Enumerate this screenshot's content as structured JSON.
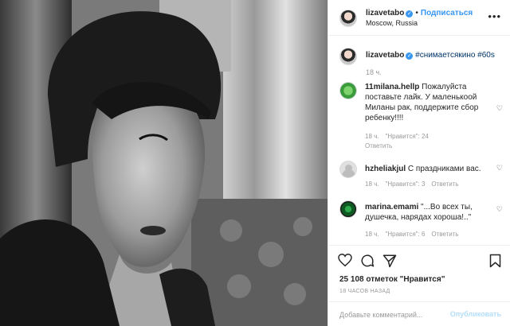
{
  "post": {
    "photo_alt": "",
    "header": {
      "username": "lizavetabo",
      "separator": "•",
      "follow_label": "Подписаться",
      "location": "Moscow, Russia",
      "more": "•••"
    },
    "caption": {
      "username": "lizavetabo",
      "hashtags": "#снимаетсякино #60s",
      "time": "18 ч."
    },
    "comments": [
      {
        "username": "11milana.hellp",
        "text": "Пожалуйста поставьте лайк. У маленькоой Миланы рак, поддержите сбор ребенку!!!!",
        "time": "18 ч.",
        "likes": "\"Нравится\": 24",
        "reply": "Ответить"
      },
      {
        "username": "hzheliakjul",
        "text": "С праздниками вас.",
        "time": "18 ч.",
        "likes": "\"Нравится\": 3",
        "reply": "Ответить"
      },
      {
        "username": "marina.emami",
        "text": "\"...Во всех ты, душечка, нарядах хороша!..\"",
        "time": "18 ч.",
        "likes": "\"Нравится\": 6",
        "reply": "Ответить"
      }
    ],
    "likes_count": "25 108 отметок \"Нравится\"",
    "time_ago": "18 ЧАСОВ НАЗАД",
    "comment_placeholder": "Добавьте комментарий...",
    "publish_label": "Опубликовать"
  },
  "colors": {
    "link_blue": "#3897f0",
    "hashtag": "#003569",
    "muted": "#999999",
    "publish_disabled": "#b2dffc"
  }
}
